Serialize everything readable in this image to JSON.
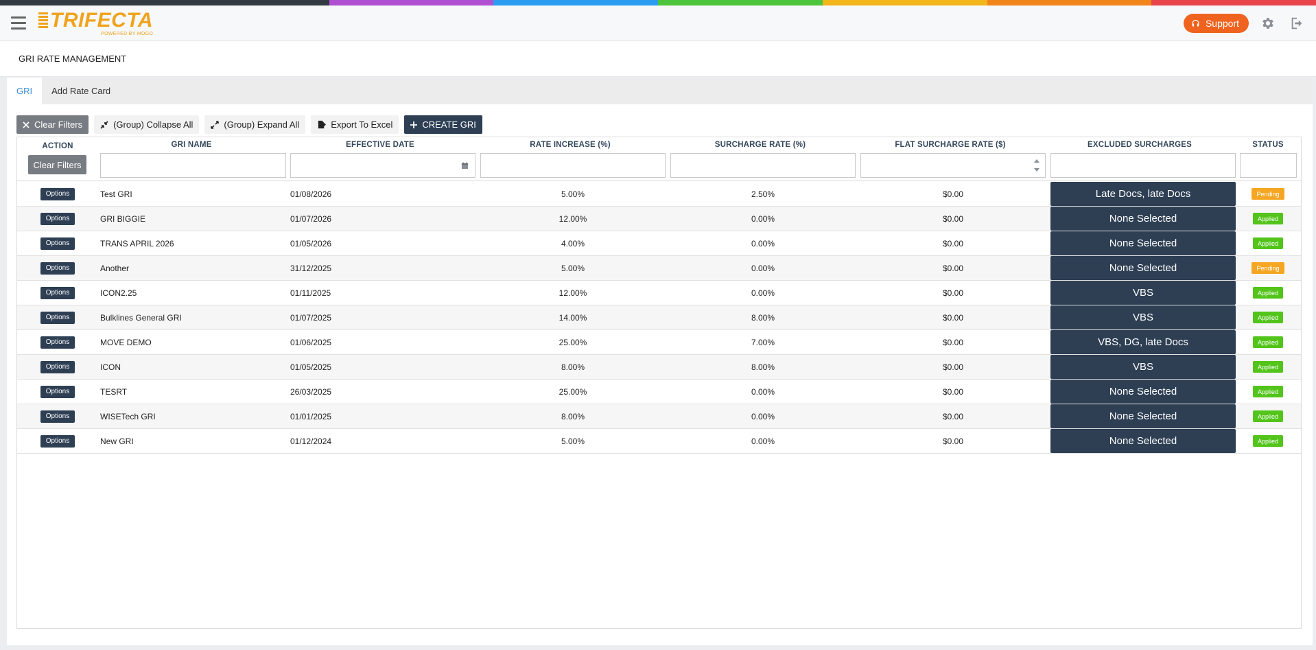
{
  "rainbow_colors": [
    "#333a42",
    "#333a42",
    "#b04fd1",
    "#2a9df0",
    "#4cc43c",
    "#f2b51a",
    "#f2851a",
    "#e8454a"
  ],
  "logo": {
    "name": "TRIFECTA",
    "powered_by": "POWERED BY MOGO",
    "color": "#f0a31c"
  },
  "topbar": {
    "support_label": "Support",
    "support_color": "#f0631e",
    "icons": [
      "headset-icon",
      "gear-icon",
      "sign-out-icon"
    ]
  },
  "page_title": "GRI RATE MANAGEMENT",
  "tabs": [
    {
      "label": "GRI",
      "active": true
    },
    {
      "label": "Add Rate Card",
      "active": false
    }
  ],
  "toolbar": {
    "clear_filters": "Clear Filters",
    "collapse_all": "(Group) Collapse All",
    "expand_all": "(Group) Expand All",
    "export": "Export To Excel",
    "create": "CREATE GRI"
  },
  "grid": {
    "columns": [
      "ACTION",
      "GRI NAME",
      "EFFECTIVE DATE",
      "RATE INCREASE (%)",
      "SURCHARGE RATE (%)",
      "FLAT SURCHARGE RATE ($)",
      "EXCLUDED SURCHARGES",
      "STATUS"
    ],
    "header_clear_filters": "Clear Filters",
    "options_label": "Options",
    "rows": [
      {
        "name": "Test GRI",
        "date": "01/08/2026",
        "rate": "5.00%",
        "surcharge": "2.50%",
        "flat": "$0.00",
        "excluded": "Late Docs, late Docs",
        "status": "Pending"
      },
      {
        "name": "GRI BIGGIE",
        "date": "01/07/2026",
        "rate": "12.00%",
        "surcharge": "0.00%",
        "flat": "$0.00",
        "excluded": "None Selected",
        "status": "Applied"
      },
      {
        "name": "TRANS APRIL 2026",
        "date": "01/05/2026",
        "rate": "4.00%",
        "surcharge": "0.00%",
        "flat": "$0.00",
        "excluded": "None Selected",
        "status": "Applied"
      },
      {
        "name": "Another",
        "date": "31/12/2025",
        "rate": "5.00%",
        "surcharge": "0.00%",
        "flat": "$0.00",
        "excluded": "None Selected",
        "status": "Pending"
      },
      {
        "name": "ICON2.25",
        "date": "01/11/2025",
        "rate": "12.00%",
        "surcharge": "0.00%",
        "flat": "$0.00",
        "excluded": "VBS",
        "status": "Applied"
      },
      {
        "name": "Bulklines General GRI",
        "date": "01/07/2025",
        "rate": "14.00%",
        "surcharge": "8.00%",
        "flat": "$0.00",
        "excluded": "VBS",
        "status": "Applied"
      },
      {
        "name": "MOVE DEMO",
        "date": "01/06/2025",
        "rate": "25.00%",
        "surcharge": "7.00%",
        "flat": "$0.00",
        "excluded": "VBS, DG, late Docs",
        "status": "Applied"
      },
      {
        "name": "ICON",
        "date": "01/05/2025",
        "rate": "8.00%",
        "surcharge": "8.00%",
        "flat": "$0.00",
        "excluded": "VBS",
        "status": "Applied"
      },
      {
        "name": "TESRT",
        "date": "26/03/2025",
        "rate": "25.00%",
        "surcharge": "0.00%",
        "flat": "$0.00",
        "excluded": "None Selected",
        "status": "Applied"
      },
      {
        "name": "WISETech GRI",
        "date": "01/01/2025",
        "rate": "8.00%",
        "surcharge": "0.00%",
        "flat": "$0.00",
        "excluded": "None Selected",
        "status": "Applied"
      },
      {
        "name": "New GRI",
        "date": "01/12/2024",
        "rate": "5.00%",
        "surcharge": "0.00%",
        "flat": "$0.00",
        "excluded": "None Selected",
        "status": "Applied"
      }
    ]
  }
}
